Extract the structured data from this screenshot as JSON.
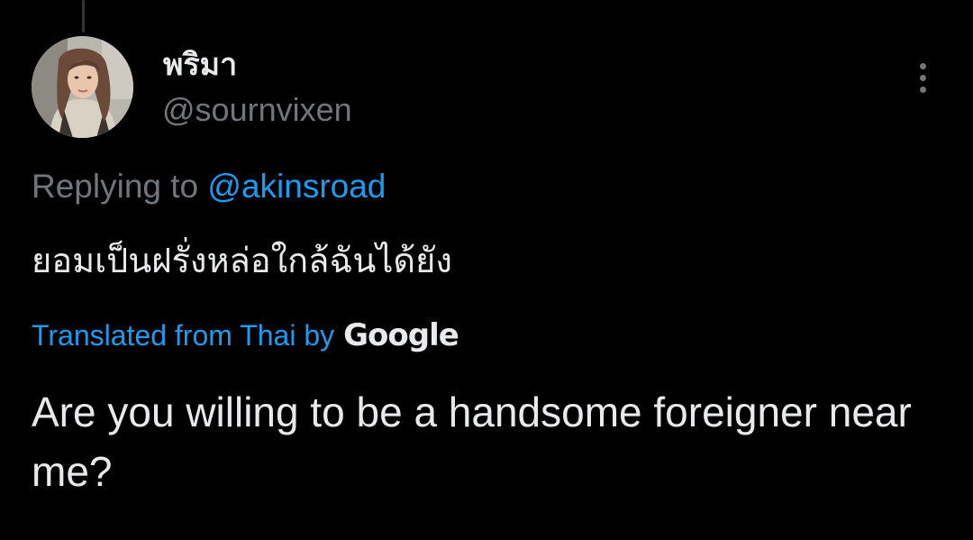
{
  "tweet": {
    "display_name": "พริมา",
    "handle": "@sournvixen",
    "avatar_alt": "profile photo",
    "more_icon": "more-vertical-icon",
    "reply_prefix": "Replying to",
    "reply_mention": "@akinsroad",
    "original_text": "ยอมเป็นฝรั่งหล่อใกล้ฉันได้ยัง",
    "translated_from": "Translated from Thai by",
    "translator_brand": "Google",
    "translated_text": "Are you willing to be a handsome foreigner near me?"
  },
  "colors": {
    "background": "#000000",
    "primary_text": "#e7e9ea",
    "secondary_text": "#71767b",
    "accent": "#1d9bf0"
  }
}
